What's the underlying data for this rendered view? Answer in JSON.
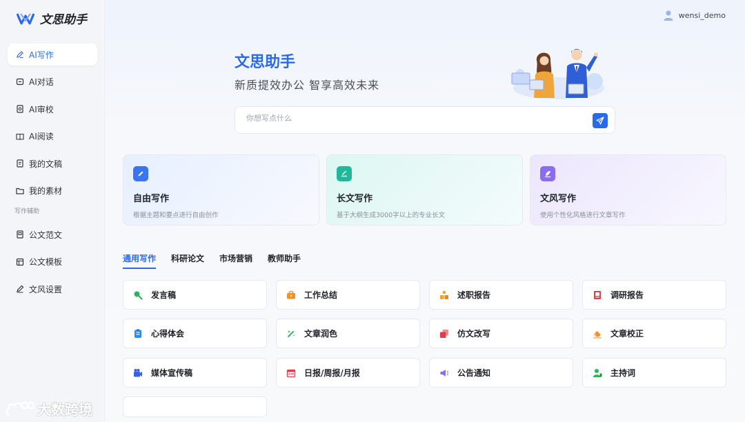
{
  "app": {
    "name": "文思助手"
  },
  "sidebar": {
    "items": [
      {
        "label": "AI写作",
        "icon": "pen-icon",
        "active": true
      },
      {
        "label": "AI对话",
        "icon": "chat-icon"
      },
      {
        "label": "AI审校",
        "icon": "review-icon"
      },
      {
        "label": "AI阅读",
        "icon": "book-icon"
      },
      {
        "label": "我的文稿",
        "icon": "document-icon"
      },
      {
        "label": "我的素材",
        "icon": "folder-icon"
      }
    ],
    "section_label": "写作辅助",
    "aux_items": [
      {
        "label": "公文范文",
        "icon": "file-icon"
      },
      {
        "label": "公文模板",
        "icon": "template-icon"
      },
      {
        "label": "文风设置",
        "icon": "style-icon"
      }
    ]
  },
  "header": {
    "username": "wensi_demo"
  },
  "hero": {
    "title": "文思助手",
    "subtitle": "新质提效办公  智享高效未来",
    "search_placeholder": "你想写点什么"
  },
  "cards": [
    {
      "title": "自由写作",
      "desc": "根据主题和要点进行自由创作",
      "color": "#3a74f2"
    },
    {
      "title": "长文写作",
      "desc": "基于大纲生成3000字以上的专业长文",
      "color": "#1fb89a"
    },
    {
      "title": "文风写作",
      "desc": "使用个性化风格进行文章写作",
      "color": "#8b6cf0"
    }
  ],
  "tabs": [
    "通用写作",
    "科研论文",
    "市场营销",
    "教师助手"
  ],
  "tiles": [
    {
      "label": "发言稿",
      "icon": "microphone-icon",
      "color": "#2db35f"
    },
    {
      "label": "工作总结",
      "icon": "briefcase-icon",
      "color": "#f0922b"
    },
    {
      "label": "述职报告",
      "icon": "people-icon",
      "color": "#f0a52b"
    },
    {
      "label": "调研报告",
      "icon": "report-icon",
      "color": "#e23c4a"
    },
    {
      "label": "心得体会",
      "icon": "notebook-icon",
      "color": "#2f8fe8"
    },
    {
      "label": "文章润色",
      "icon": "wand-icon",
      "color": "#2db35f"
    },
    {
      "label": "仿文改写",
      "icon": "copy-icon",
      "color": "#e23c4a"
    },
    {
      "label": "文章校正",
      "icon": "eraser-icon",
      "color": "#f0922b"
    },
    {
      "label": "媒体宣传稿",
      "icon": "camera-icon",
      "color": "#3a5fe0"
    },
    {
      "label": "日报/周报/月报",
      "icon": "calendar-icon",
      "color": "#e23c4a"
    },
    {
      "label": "公告通知",
      "icon": "megaphone-icon",
      "color": "#8b6cf0"
    },
    {
      "label": "主持词",
      "icon": "host-icon",
      "color": "#2db35f"
    }
  ],
  "watermark": {
    "text": "大数跨境"
  }
}
